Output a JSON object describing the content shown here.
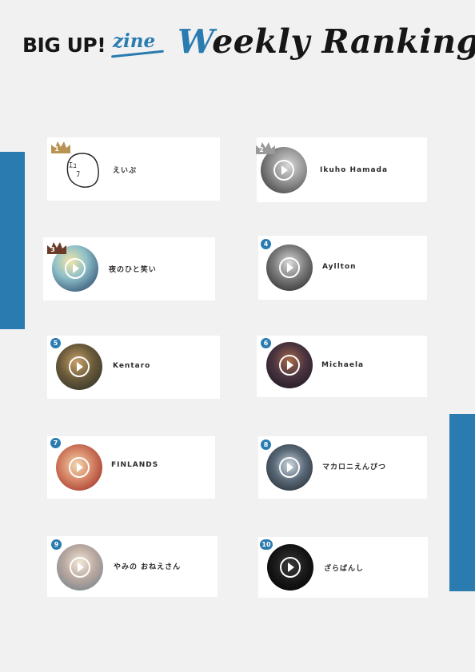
{
  "brand": {
    "logo_text": "BIG UP!",
    "logo_sub": "zine",
    "title_first": "W",
    "title_rest": "eekly Ranking"
  },
  "colors": {
    "accent": "#2a7bb0",
    "gold": "#b89352",
    "silver": "#9a9a9a",
    "bronze": "#6b3a28",
    "background": "#f1f1f2"
  },
  "ranking": [
    {
      "rank": "1",
      "name": "えいぷ",
      "marker": "crown-gold",
      "avatar": "doodle-face"
    },
    {
      "rank": "2",
      "name": "Ikuho Hamada",
      "marker": "crown-silver",
      "avatar": "photo"
    },
    {
      "rank": "3",
      "name": "夜のひと笑い",
      "marker": "crown-bronze",
      "avatar": "photo"
    },
    {
      "rank": "4",
      "name": "Ayllton",
      "marker": "circle",
      "avatar": "photo"
    },
    {
      "rank": "5",
      "name": "Kentaro",
      "marker": "circle",
      "avatar": "photo"
    },
    {
      "rank": "6",
      "name": "Michaela",
      "marker": "circle",
      "avatar": "photo"
    },
    {
      "rank": "7",
      "name": "FINLANDS",
      "marker": "circle",
      "avatar": "photo"
    },
    {
      "rank": "8",
      "name": "マカロニえんぴつ",
      "marker": "circle",
      "avatar": "photo"
    },
    {
      "rank": "9",
      "name": "やみの おねえさん",
      "marker": "circle",
      "avatar": "photo"
    },
    {
      "rank": "10",
      "name": "ざらばんし",
      "marker": "circle",
      "avatar": "photo"
    }
  ]
}
